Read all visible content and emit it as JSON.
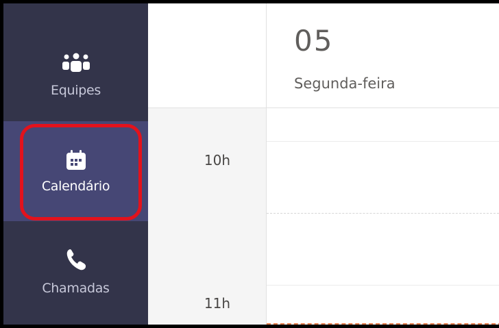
{
  "rail": {
    "items": [
      {
        "label": "Equipes",
        "icon": "teams-icon"
      },
      {
        "label": "Calendário",
        "icon": "calendar-icon",
        "selected": true
      },
      {
        "label": "Chamadas",
        "icon": "phone-icon"
      }
    ],
    "background": "#33344a",
    "selected_background": "#464775",
    "highlight_color": "#e3121c"
  },
  "calendar": {
    "day": {
      "number": "05",
      "name": "Segunda-feira"
    },
    "hours": [
      "10h",
      "11h"
    ],
    "current_time_color": "#e67e4d"
  }
}
